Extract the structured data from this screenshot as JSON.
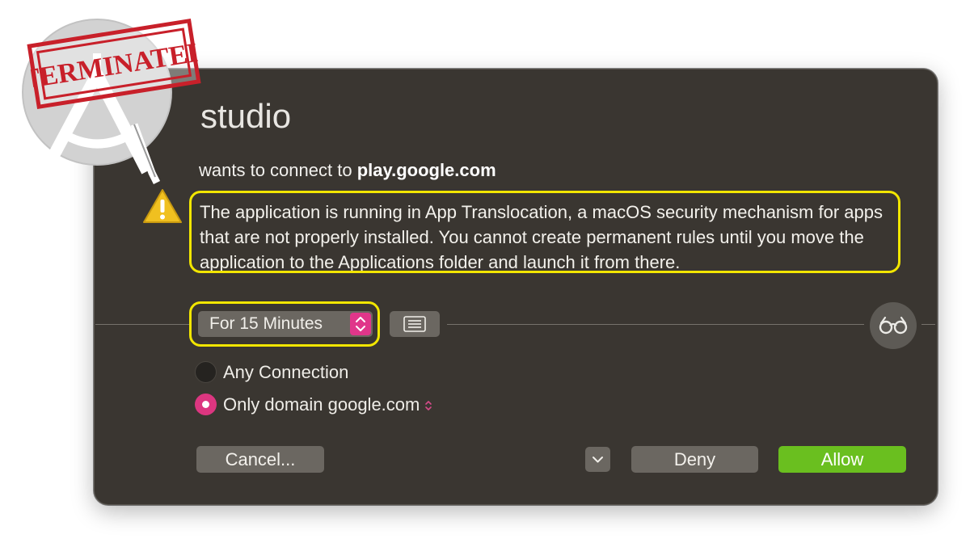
{
  "app": {
    "name": "studio"
  },
  "stamp": {
    "text": "TERMINATED",
    "color": "#c8202a"
  },
  "connection": {
    "prefix": "wants to connect to",
    "host": "play.google.com"
  },
  "notice": {
    "text": "The application is running in App Translocation, a macOS security mechanism for apps that are not properly installed. You cannot create permanent rules until you move the application to the Applications folder and launch it from there.",
    "highlight_color": "#f2e600"
  },
  "duration": {
    "selected": "For 15 Minutes"
  },
  "scope": {
    "options": [
      {
        "label": "Any Connection",
        "selected": false
      },
      {
        "label": "Only domain google.com",
        "selected": true
      }
    ]
  },
  "buttons": {
    "cancel": "Cancel...",
    "deny": "Deny",
    "allow": "Allow"
  },
  "icons": {
    "app": "android-studio-icon",
    "warning": "warning-icon",
    "list": "list-icon",
    "glasses": "glasses-icon",
    "chevron": "chevron-down-icon"
  },
  "colors": {
    "accent": "#e0368a",
    "allow": "#6abf1f",
    "panel": "#3a3631"
  }
}
